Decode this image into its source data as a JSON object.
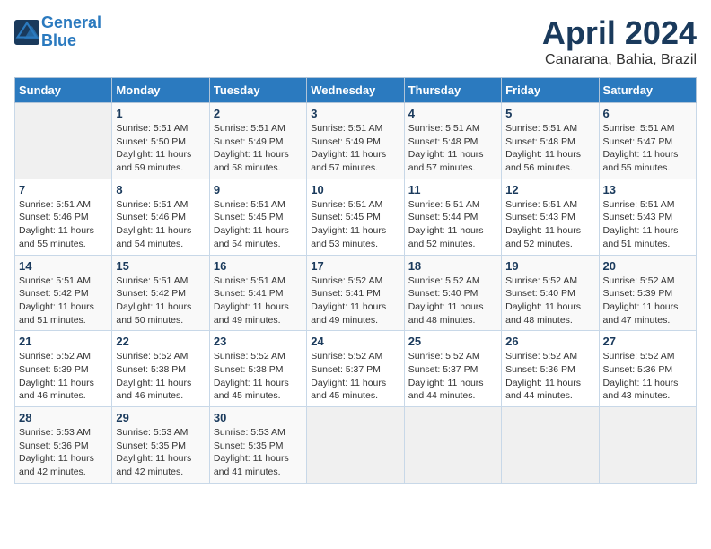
{
  "header": {
    "logo_line1": "General",
    "logo_line2": "Blue",
    "month_title": "April 2024",
    "subtitle": "Canarana, Bahia, Brazil"
  },
  "calendar": {
    "days_of_week": [
      "Sunday",
      "Monday",
      "Tuesday",
      "Wednesday",
      "Thursday",
      "Friday",
      "Saturday"
    ],
    "weeks": [
      [
        {
          "day": "",
          "info": ""
        },
        {
          "day": "1",
          "info": "Sunrise: 5:51 AM\nSunset: 5:50 PM\nDaylight: 11 hours\nand 59 minutes."
        },
        {
          "day": "2",
          "info": "Sunrise: 5:51 AM\nSunset: 5:49 PM\nDaylight: 11 hours\nand 58 minutes."
        },
        {
          "day": "3",
          "info": "Sunrise: 5:51 AM\nSunset: 5:49 PM\nDaylight: 11 hours\nand 57 minutes."
        },
        {
          "day": "4",
          "info": "Sunrise: 5:51 AM\nSunset: 5:48 PM\nDaylight: 11 hours\nand 57 minutes."
        },
        {
          "day": "5",
          "info": "Sunrise: 5:51 AM\nSunset: 5:48 PM\nDaylight: 11 hours\nand 56 minutes."
        },
        {
          "day": "6",
          "info": "Sunrise: 5:51 AM\nSunset: 5:47 PM\nDaylight: 11 hours\nand 55 minutes."
        }
      ],
      [
        {
          "day": "7",
          "info": "Sunrise: 5:51 AM\nSunset: 5:46 PM\nDaylight: 11 hours\nand 55 minutes."
        },
        {
          "day": "8",
          "info": "Sunrise: 5:51 AM\nSunset: 5:46 PM\nDaylight: 11 hours\nand 54 minutes."
        },
        {
          "day": "9",
          "info": "Sunrise: 5:51 AM\nSunset: 5:45 PM\nDaylight: 11 hours\nand 54 minutes."
        },
        {
          "day": "10",
          "info": "Sunrise: 5:51 AM\nSunset: 5:45 PM\nDaylight: 11 hours\nand 53 minutes."
        },
        {
          "day": "11",
          "info": "Sunrise: 5:51 AM\nSunset: 5:44 PM\nDaylight: 11 hours\nand 52 minutes."
        },
        {
          "day": "12",
          "info": "Sunrise: 5:51 AM\nSunset: 5:43 PM\nDaylight: 11 hours\nand 52 minutes."
        },
        {
          "day": "13",
          "info": "Sunrise: 5:51 AM\nSunset: 5:43 PM\nDaylight: 11 hours\nand 51 minutes."
        }
      ],
      [
        {
          "day": "14",
          "info": "Sunrise: 5:51 AM\nSunset: 5:42 PM\nDaylight: 11 hours\nand 51 minutes."
        },
        {
          "day": "15",
          "info": "Sunrise: 5:51 AM\nSunset: 5:42 PM\nDaylight: 11 hours\nand 50 minutes."
        },
        {
          "day": "16",
          "info": "Sunrise: 5:51 AM\nSunset: 5:41 PM\nDaylight: 11 hours\nand 49 minutes."
        },
        {
          "day": "17",
          "info": "Sunrise: 5:52 AM\nSunset: 5:41 PM\nDaylight: 11 hours\nand 49 minutes."
        },
        {
          "day": "18",
          "info": "Sunrise: 5:52 AM\nSunset: 5:40 PM\nDaylight: 11 hours\nand 48 minutes."
        },
        {
          "day": "19",
          "info": "Sunrise: 5:52 AM\nSunset: 5:40 PM\nDaylight: 11 hours\nand 48 minutes."
        },
        {
          "day": "20",
          "info": "Sunrise: 5:52 AM\nSunset: 5:39 PM\nDaylight: 11 hours\nand 47 minutes."
        }
      ],
      [
        {
          "day": "21",
          "info": "Sunrise: 5:52 AM\nSunset: 5:39 PM\nDaylight: 11 hours\nand 46 minutes."
        },
        {
          "day": "22",
          "info": "Sunrise: 5:52 AM\nSunset: 5:38 PM\nDaylight: 11 hours\nand 46 minutes."
        },
        {
          "day": "23",
          "info": "Sunrise: 5:52 AM\nSunset: 5:38 PM\nDaylight: 11 hours\nand 45 minutes."
        },
        {
          "day": "24",
          "info": "Sunrise: 5:52 AM\nSunset: 5:37 PM\nDaylight: 11 hours\nand 45 minutes."
        },
        {
          "day": "25",
          "info": "Sunrise: 5:52 AM\nSunset: 5:37 PM\nDaylight: 11 hours\nand 44 minutes."
        },
        {
          "day": "26",
          "info": "Sunrise: 5:52 AM\nSunset: 5:36 PM\nDaylight: 11 hours\nand 44 minutes."
        },
        {
          "day": "27",
          "info": "Sunrise: 5:52 AM\nSunset: 5:36 PM\nDaylight: 11 hours\nand 43 minutes."
        }
      ],
      [
        {
          "day": "28",
          "info": "Sunrise: 5:53 AM\nSunset: 5:36 PM\nDaylight: 11 hours\nand 42 minutes."
        },
        {
          "day": "29",
          "info": "Sunrise: 5:53 AM\nSunset: 5:35 PM\nDaylight: 11 hours\nand 42 minutes."
        },
        {
          "day": "30",
          "info": "Sunrise: 5:53 AM\nSunset: 5:35 PM\nDaylight: 11 hours\nand 41 minutes."
        },
        {
          "day": "",
          "info": ""
        },
        {
          "day": "",
          "info": ""
        },
        {
          "day": "",
          "info": ""
        },
        {
          "day": "",
          "info": ""
        }
      ]
    ]
  }
}
